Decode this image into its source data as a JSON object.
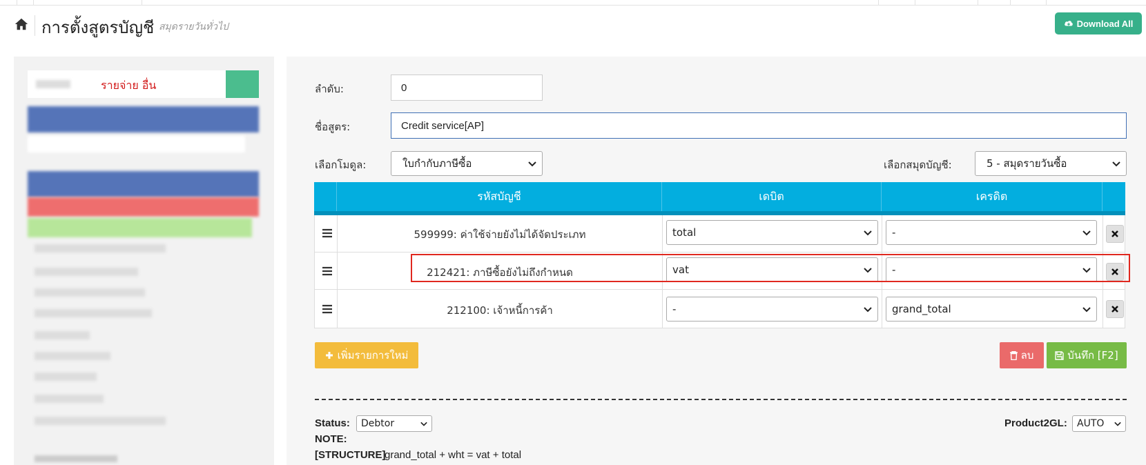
{
  "header": {
    "title": "การตั้งสูตรบัญชี",
    "subtitle": "สมุดรายวันทั่วไป",
    "download_label": "Download All",
    "home_icon": "home-icon",
    "download_icon": "cloud-download-icon"
  },
  "sidebar": {
    "top_label": "รายจ่าย  อื่น"
  },
  "form": {
    "order_label": "ลำดับ:",
    "order_value": "0",
    "name_label": "ชื่อสูตร:",
    "name_value": "Credit service[AP]",
    "module_label": "เลือกโมดูล:",
    "module_value": "ใบกำกับภาษีซื้อ",
    "journal_label": "เลือกสมุดบัญชี:",
    "journal_value": "5 - สมุดรายวันซื้อ"
  },
  "table": {
    "headers": {
      "account": "รหัสบัญชี",
      "debit": "เดบิต",
      "credit": "เครดิต"
    },
    "rows": [
      {
        "account": "599999: ค่าใช้จ่ายยังไม่ได้จัดประเภท",
        "debit": "total",
        "credit": "-"
      },
      {
        "account": "212421: ภาษีซื้อยังไม่ถึงกำหนด",
        "debit": "vat",
        "credit": "-"
      },
      {
        "account": "212100: เจ้าหนี้การค้า",
        "debit": "-",
        "credit": "grand_total"
      }
    ]
  },
  "actions": {
    "add_label": "เพิ่มรายการใหม่",
    "delete_label": "ลบ",
    "save_label": "บันทึก [F2]"
  },
  "footer": {
    "status_label": "Status:",
    "status_value": "Debtor",
    "note_label": "NOTE:",
    "structure_label": "[STRUCTURE]",
    "structure_value": "grand_total + wht = vat + total",
    "product2gl_label": "Product2GL:",
    "product2gl_value": "AUTO"
  },
  "colors": {
    "table_header": "#03aedf",
    "add_button": "#f3bc3c",
    "delete_button": "#ea6a6a",
    "save_button": "#77bb46",
    "download_button": "#37b08a",
    "highlight": "#e0281f"
  }
}
